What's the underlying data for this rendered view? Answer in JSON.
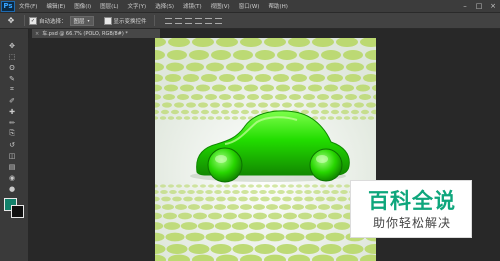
{
  "app": {
    "logo": "Ps"
  },
  "menu": [
    "文件(F)",
    "编辑(E)",
    "图像(I)",
    "图层(L)",
    "文字(Y)",
    "选择(S)",
    "滤镜(T)",
    "视图(V)",
    "窗口(W)",
    "帮助(H)"
  ],
  "window_controls": {
    "minimize": "–",
    "maximize": "□",
    "close": "×"
  },
  "options": {
    "auto_select_label": "自动选择：",
    "auto_select_value": "图层",
    "show_transform_label": "显示变换控件"
  },
  "document": {
    "tab_title": "车.psd @ 66.7% (POLO, RGB/8#) *",
    "close": "×"
  },
  "tools": [
    "move-tool",
    "marquee-tool",
    "lasso-tool",
    "quick-select-tool",
    "crop-tool",
    "eyedropper-tool",
    "healing-tool",
    "brush-tool",
    "clone-stamp-tool",
    "history-brush-tool",
    "eraser-tool",
    "gradient-tool",
    "blur-tool",
    "dodge-tool",
    "pen-tool",
    "type-tool",
    "path-select-tool",
    "shape-tool",
    "hand-tool",
    "zoom-tool"
  ],
  "tool_glyphs": [
    "✥",
    "⬚",
    "ʘ",
    "✎",
    "⌗",
    "✐",
    "✚",
    "✏",
    "⎘",
    "↺",
    "◫",
    "▤",
    "◉",
    "●",
    "✒",
    "T",
    "➤",
    "▭",
    "✋",
    "⚲"
  ],
  "colors": {
    "foreground": "#13806a",
    "background": "#101010",
    "car": "#22dd00",
    "dots": "#b9d86a"
  },
  "watermark": {
    "title": "百科全说",
    "subtitle": "助你轻松解决"
  }
}
